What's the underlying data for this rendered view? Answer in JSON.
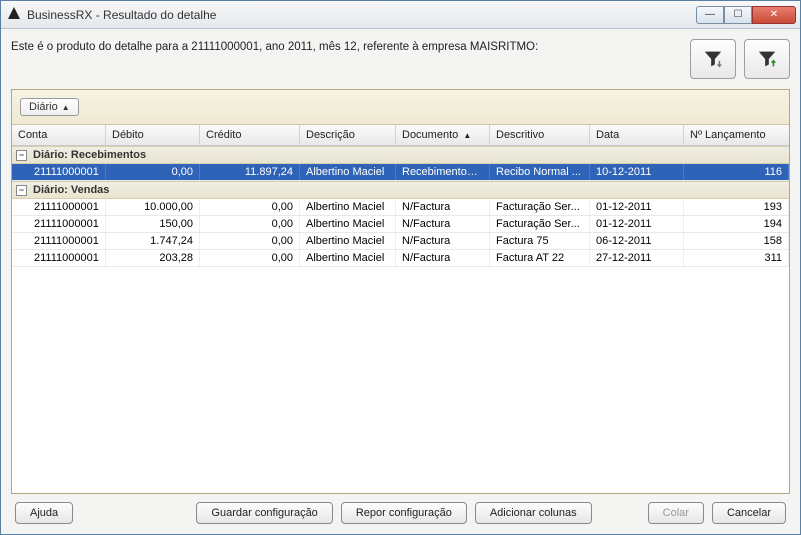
{
  "window": {
    "title": "BusinessRX - Resultado do detalhe"
  },
  "header": {
    "description": "Este é o produto do detalhe para a  21111000001, ano 2011, mês 12, referente à empresa MAISRITMO:"
  },
  "grid": {
    "group_by_label": "Diário",
    "columns": {
      "conta": "Conta",
      "debito": "Débito",
      "credito": "Crédito",
      "descricao": "Descrição",
      "documento": "Documento",
      "descritivo": "Descritivo",
      "data": "Data",
      "lancamento": "Nº Lançamento"
    },
    "groups": [
      {
        "label": "Diário: Recebimentos",
        "rows": [
          {
            "conta": "21111000001",
            "debito": "0,00",
            "credito": "11.897,24",
            "descricao": "Albertino Maciel",
            "documento": "Recebimentos ...",
            "descritivo": "Recibo Normal ...",
            "data": "10-12-2011",
            "lancamento": "116",
            "selected": true
          }
        ]
      },
      {
        "label": "Diário: Vendas",
        "rows": [
          {
            "conta": "21111000001",
            "debito": "10.000,00",
            "credito": "0,00",
            "descricao": "Albertino Maciel",
            "documento": "N/Factura",
            "descritivo": "Facturação Ser...",
            "data": "01-12-2011",
            "lancamento": "193"
          },
          {
            "conta": "21111000001",
            "debito": "150,00",
            "credito": "0,00",
            "descricao": "Albertino Maciel",
            "documento": "N/Factura",
            "descritivo": "Facturação Ser...",
            "data": "01-12-2011",
            "lancamento": "194"
          },
          {
            "conta": "21111000001",
            "debito": "1.747,24",
            "credito": "0,00",
            "descricao": "Albertino Maciel",
            "documento": "N/Factura",
            "descritivo": "Factura 75",
            "data": "06-12-2011",
            "lancamento": "158"
          },
          {
            "conta": "21111000001",
            "debito": "203,28",
            "credito": "0,00",
            "descricao": "Albertino Maciel",
            "documento": "N/Factura",
            "descritivo": "Factura AT 22",
            "data": "27-12-2011",
            "lancamento": "311"
          }
        ]
      }
    ]
  },
  "footer": {
    "ajuda": "Ajuda",
    "guardar": "Guardar configuração",
    "repor": "Repor configuração",
    "adicionar": "Adicionar colunas",
    "colar": "Colar",
    "cancelar": "Cancelar"
  }
}
